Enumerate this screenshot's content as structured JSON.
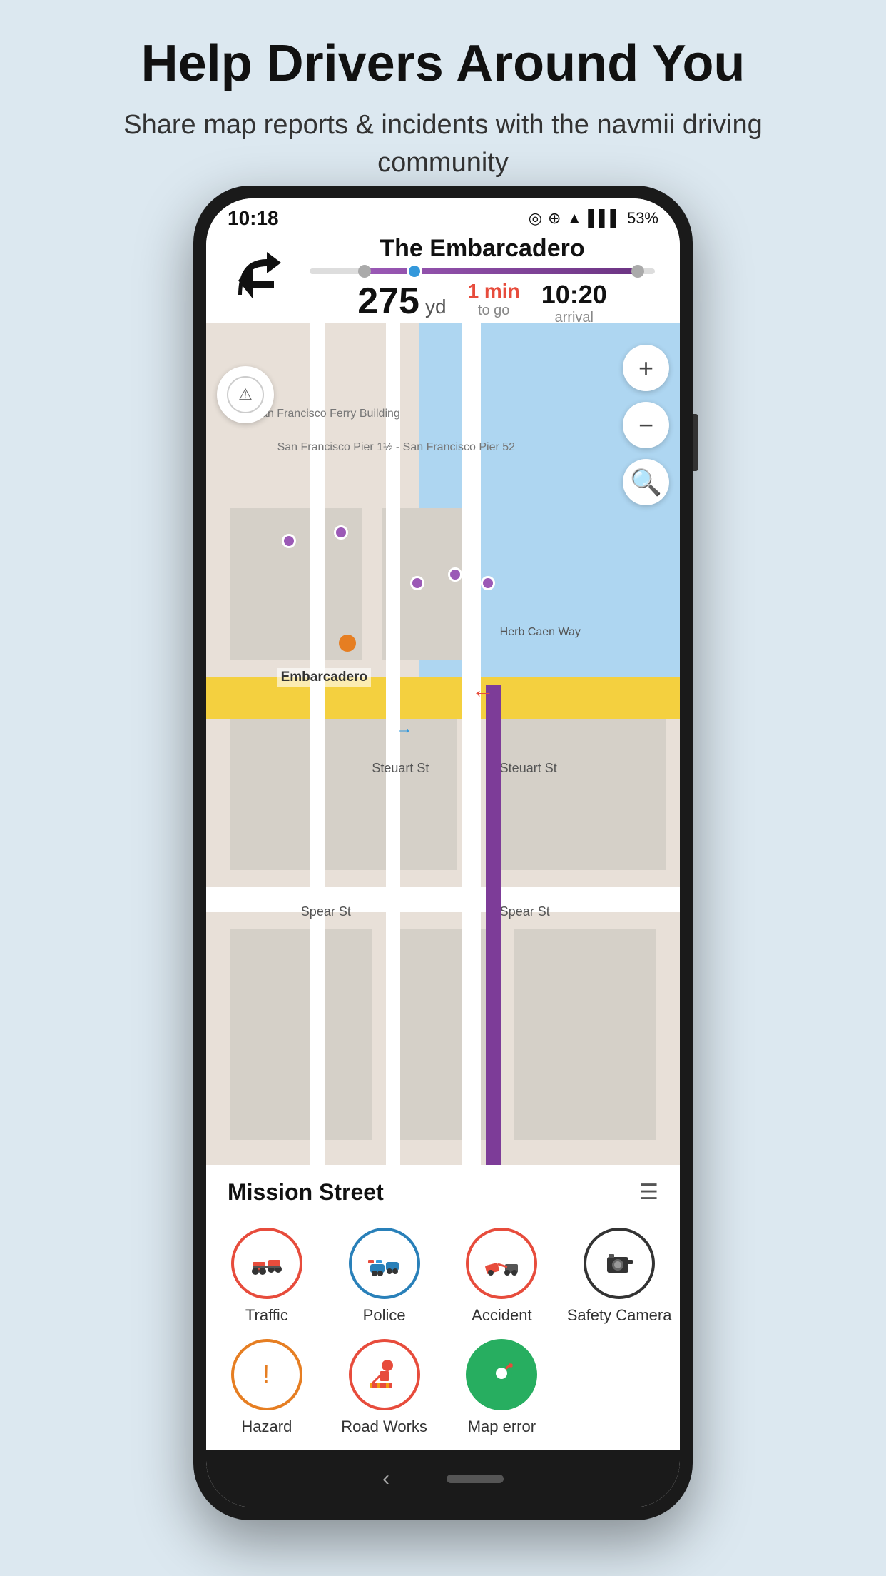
{
  "page": {
    "title": "Help Drivers Around You",
    "subtitle": "Share map reports & incidents with the navmii driving community"
  },
  "status_bar": {
    "time": "10:18",
    "battery": "53%",
    "icons": "◎ ⊕ ▲ ▌▌▌ 🔋"
  },
  "navigation": {
    "street_name": "The Embarcadero",
    "distance_value": "275",
    "distance_unit": "yd",
    "time_value": "1 min",
    "time_label": "to go",
    "arrival_value": "10:20",
    "arrival_label": "arrival"
  },
  "map": {
    "street_embarcadero": "Embarcadero",
    "street_steuart_left": "Steuart St",
    "street_steuart_right": "Steuart St",
    "street_spear_left": "Spear St",
    "street_spear_right": "Spear St",
    "street_herb": "Herb Caen Way",
    "street_pier": "San Francisco Pier 1½ - San Francisco Pier 52",
    "street_ferry": "San Francisco Ferry Building"
  },
  "bottom_panel": {
    "street_name": "Mission Street",
    "menu_icon": "☰"
  },
  "report_items_row1": [
    {
      "id": "traffic",
      "label": "Traffic",
      "icon": "🚗",
      "border_color": "#e74c3c"
    },
    {
      "id": "police",
      "label": "Police",
      "icon": "🚔",
      "border_color": "#2980b9"
    },
    {
      "id": "accident",
      "label": "Accident",
      "icon": "🚧",
      "border_color": "#e74c3c"
    },
    {
      "id": "safety-camera",
      "label": "Safety Camera",
      "icon": "📷",
      "border_color": "#333"
    }
  ],
  "report_items_row2": [
    {
      "id": "hazard",
      "label": "Hazard",
      "icon": "❗",
      "border_color": "#e67e22"
    },
    {
      "id": "road-works",
      "label": "Road Works",
      "icon": "👷",
      "border_color": "#e74c3c"
    },
    {
      "id": "map-error",
      "label": "Map error",
      "icon": "📍",
      "border_color": "#27ae60",
      "bg": "#27ae60"
    }
  ],
  "buttons": {
    "zoom_in": "+",
    "zoom_out": "−",
    "search": "🔍",
    "back": "‹"
  }
}
